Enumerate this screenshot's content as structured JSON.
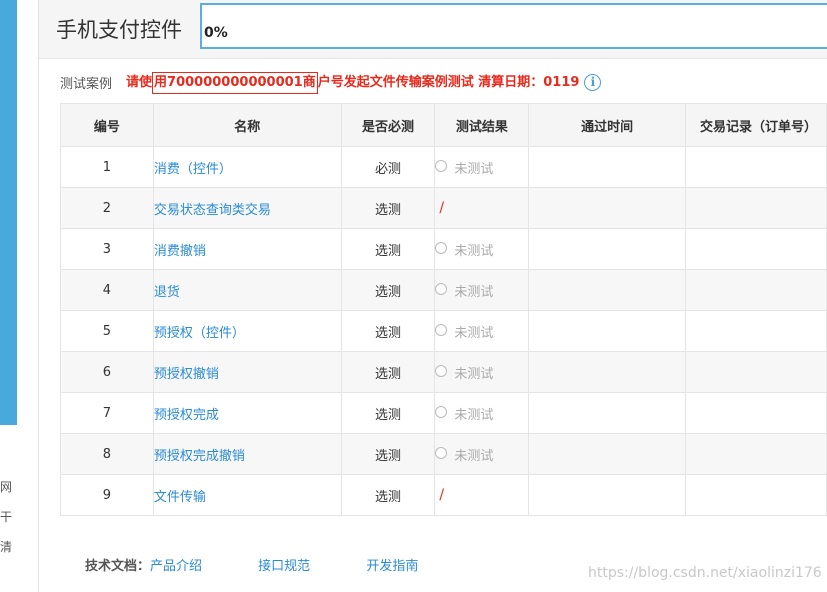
{
  "sidebar": {
    "chars": [
      "网",
      "干",
      "清"
    ]
  },
  "header": {
    "title": "手机支付控件",
    "progress": "0%"
  },
  "case_info": {
    "label": "测试案例",
    "notice_prefix": "请使",
    "merchant_boxed": "用700000000000001商",
    "notice_suffix": "户号发起文件传输案例测试 清算日期：0119",
    "info_icon": "i"
  },
  "table": {
    "columns": [
      "编号",
      "名称",
      "是否必测",
      "测试结果",
      "通过时间",
      "交易记录（订单号）"
    ],
    "rows": [
      {
        "no": "1",
        "name": "消费（控件）",
        "required": "必测",
        "result": "未测试",
        "result_type": "untested"
      },
      {
        "no": "2",
        "name": "交易状态查询类交易",
        "required": "选测",
        "result": "/",
        "result_type": "na"
      },
      {
        "no": "3",
        "name": "消费撤销",
        "required": "选测",
        "result": "未测试",
        "result_type": "untested"
      },
      {
        "no": "4",
        "name": "退货",
        "required": "选测",
        "result": "未测试",
        "result_type": "untested"
      },
      {
        "no": "5",
        "name": "预授权（控件）",
        "required": "选测",
        "result": "未测试",
        "result_type": "untested"
      },
      {
        "no": "6",
        "name": "预授权撤销",
        "required": "选测",
        "result": "未测试",
        "result_type": "untested"
      },
      {
        "no": "7",
        "name": "预授权完成",
        "required": "选测",
        "result": "未测试",
        "result_type": "untested"
      },
      {
        "no": "8",
        "name": "预授权完成撤销",
        "required": "选测",
        "result": "未测试",
        "result_type": "untested"
      },
      {
        "no": "9",
        "name": "文件传输",
        "required": "选测",
        "result": "/",
        "result_type": "na"
      }
    ]
  },
  "footer": {
    "label": "技术文档：",
    "links": [
      "产品介绍",
      "接口规范",
      "开发指南"
    ]
  },
  "watermark": "https://blog.csdn.net/xiaolinzi176",
  "colors": {
    "accent_blue": "#2a8bd6",
    "warning_red": "#e8291c",
    "sidebar_blue": "#4aa9dc"
  }
}
